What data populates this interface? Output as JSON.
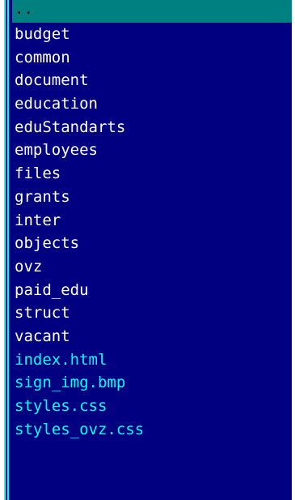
{
  "panel": {
    "colors": {
      "background": "#000080",
      "directory_text": "#ffffff",
      "file_text": "#00ffff",
      "cursor_background": "#008080",
      "cursor_text": "#000000",
      "frame": "#00ffff"
    },
    "selected_index": 0,
    "items": [
      {
        "name": "..",
        "kind": "parent"
      },
      {
        "name": "budget",
        "kind": "dir"
      },
      {
        "name": "common",
        "kind": "dir"
      },
      {
        "name": "document",
        "kind": "dir"
      },
      {
        "name": "education",
        "kind": "dir"
      },
      {
        "name": "eduStandarts",
        "kind": "dir"
      },
      {
        "name": "employees",
        "kind": "dir"
      },
      {
        "name": "files",
        "kind": "dir"
      },
      {
        "name": "grants",
        "kind": "dir"
      },
      {
        "name": "inter",
        "kind": "dir"
      },
      {
        "name": "objects",
        "kind": "dir"
      },
      {
        "name": "ovz",
        "kind": "dir"
      },
      {
        "name": "paid_edu",
        "kind": "dir"
      },
      {
        "name": "struct",
        "kind": "dir"
      },
      {
        "name": "vacant",
        "kind": "dir"
      },
      {
        "name": "index.html",
        "kind": "file"
      },
      {
        "name": "sign_img.bmp",
        "kind": "file"
      },
      {
        "name": "styles.css",
        "kind": "file"
      },
      {
        "name": "styles_ovz.css",
        "kind": "file"
      }
    ]
  }
}
